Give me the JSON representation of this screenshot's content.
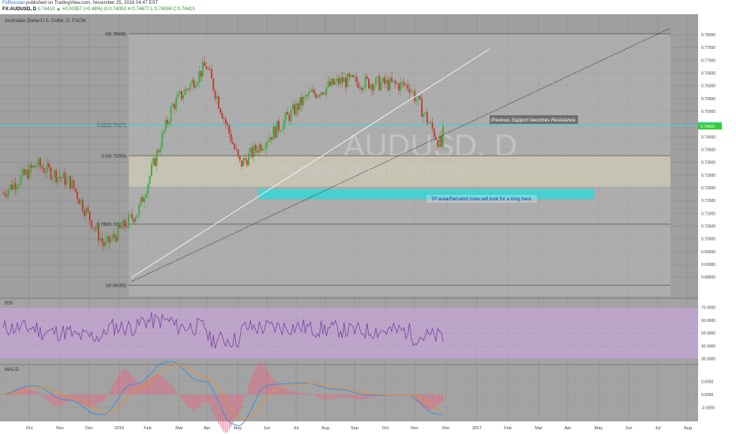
{
  "header": {
    "author": "FxRussian",
    "published": "published on TradingView.com, November 25, 2016 04:47 EST",
    "symbol": "FX:AUDUSD, D",
    "ohlc": [
      "O:0.74053",
      "H:0.74677",
      "L:0.74004",
      "C:0.74410"
    ],
    "ohlc_prefix": "0.74410 ▲ +0.00357 (+0.48%)"
  },
  "panels": {
    "price_title": "Australian Dollar/U.S. Dollar, D, FXCM",
    "watermark_symbol": "AUDUSD, D",
    "watermark_name": "Australian Dollar/U.S. Dollar",
    "rsi_title": "RSI",
    "macd_title": "MACD"
  },
  "annotations": {
    "resistance_note": "Previous Support becomes Resistance.",
    "tp_note": "TP area/Demand zone will look for a long here."
  },
  "colors": {
    "grid_bg": "#a9a9a9",
    "fib_zone": "#bdbdbd",
    "golden_zone": "#d8d2b8",
    "tp_zone": "#35d6d6",
    "support_line": "#4fd0d0",
    "rsi_band": "#c4a6d6",
    "rsi_line": "#7d3fa0",
    "macd_line": "#2f8fe0",
    "signal_line": "#f08c2a",
    "hist": "#ef6080",
    "up_candle": "#3daa3d",
    "down_candle": "#c0392b"
  },
  "chart_data": [
    {
      "type": "candlestick",
      "title": "Australian Dollar/U.S. Dollar, D, FXCM",
      "x_ticks": [
        "Oct",
        "Nov",
        "Dec",
        "2016",
        "Feb",
        "Mar",
        "Apr",
        "May",
        "Jun",
        "Jul",
        "Aug",
        "Sep",
        "Oct",
        "Nov",
        "Dec",
        "2017",
        "Feb",
        "Mar",
        "Apr",
        "May",
        "Jun",
        "Jul",
        "Aug"
      ],
      "y_ticks": [
        "0.78000",
        "0.77500",
        "0.77000",
        "0.76500",
        "0.76000",
        "0.75500",
        "0.75000",
        "0.74500",
        "0.74000",
        "0.73500",
        "0.73000",
        "0.72500",
        "0.72000",
        "0.71500",
        "0.71000",
        "0.70500",
        "0.70000",
        "0.69500",
        "0.69000",
        "0.68500"
      ],
      "y_range": [
        0.681,
        0.7825
      ],
      "fib_levels": [
        {
          "label": "0(0.78038)",
          "value": 0.78038
        },
        {
          "label": "0.382(0.74457)",
          "value": 0.74457
        },
        {
          "label": "0.5(0.73259)",
          "value": 0.73259
        },
        {
          "label": "0.786(0.70575)",
          "value": 0.70575
        },
        {
          "label": "1(0.68182)",
          "value": 0.68182
        }
      ],
      "price_badges": [
        "0.74450",
        "0.74410"
      ],
      "current_price": 0.7441,
      "monthly_path": [
        {
          "month": "Oct",
          "price": 0.718
        },
        {
          "month": "Nov",
          "price": 0.729
        },
        {
          "month": "Dec",
          "price": 0.722
        },
        {
          "month": "2016",
          "price": 0.697
        },
        {
          "month": "Feb",
          "price": 0.711
        },
        {
          "month": "Mar",
          "price": 0.752
        },
        {
          "month": "Apr",
          "price": 0.768
        },
        {
          "month": "May",
          "price": 0.729
        },
        {
          "month": "Jun",
          "price": 0.742
        },
        {
          "month": "Jul",
          "price": 0.756
        },
        {
          "month": "Aug",
          "price": 0.762
        },
        {
          "month": "Sep",
          "price": 0.761
        },
        {
          "month": "Oct",
          "price": 0.76
        },
        {
          "month": "Nov",
          "price": 0.735
        }
      ]
    },
    {
      "type": "line",
      "title": "RSI",
      "y_ticks": [
        "70.0000",
        "60.0000",
        "50.0000",
        "40.0000",
        "30.0000"
      ],
      "y_range": [
        28,
        74
      ],
      "band": [
        30,
        70
      ],
      "last_value": 43
    },
    {
      "type": "line",
      "title": "MACD",
      "y_ticks": [
        "0.0050",
        "0.0000",
        "-0.0050"
      ],
      "y_range": [
        -0.009,
        0.009
      ]
    }
  ]
}
